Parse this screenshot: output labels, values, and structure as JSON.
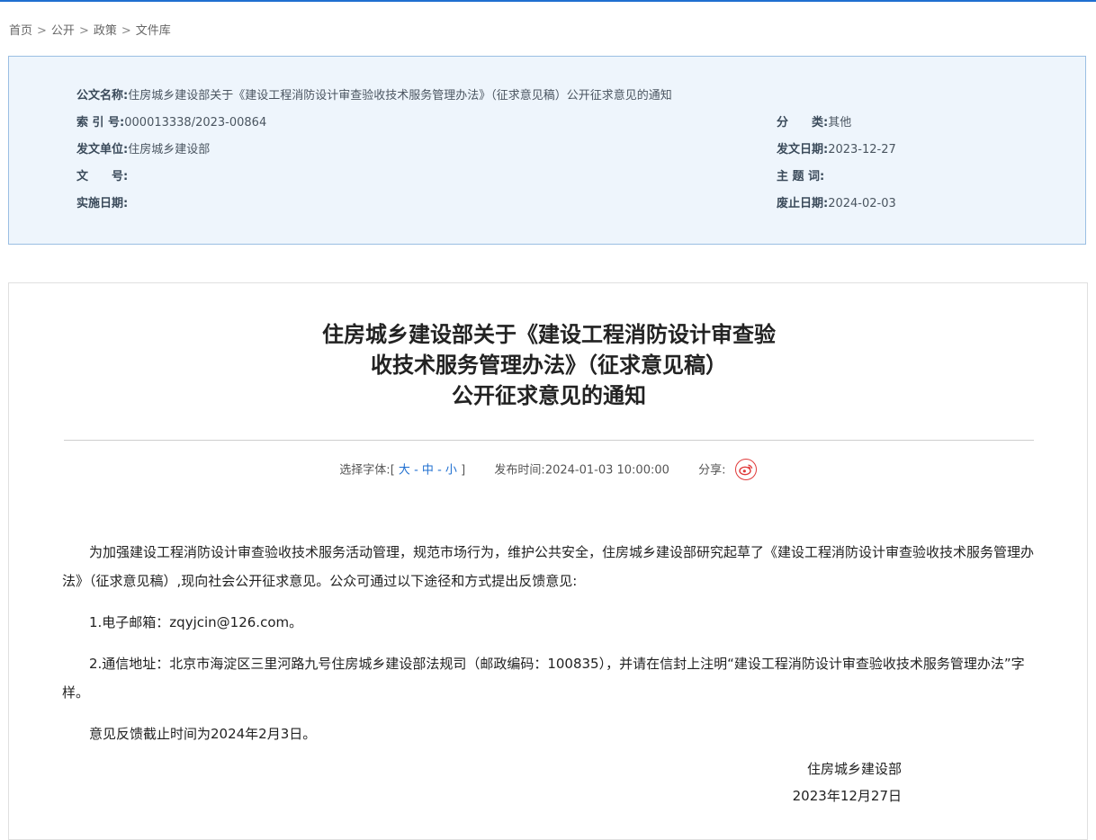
{
  "breadcrumb": {
    "items": [
      "首页",
      "公开",
      "政策",
      "文件库"
    ],
    "separator": ">"
  },
  "meta": {
    "doc_name_label": "公文名称:",
    "doc_name_value": "住房城乡建设部关于《建设工程消防设计审查验收技术服务管理办法》（征求意见稿）公开征求意见的通知",
    "index_label": "索 引 号:",
    "index_value": "000013338/2023-00864",
    "category_label": "分　　类:",
    "category_value": "其他",
    "issuer_label": "发文单位:",
    "issuer_value": "住房城乡建设部",
    "issue_date_label": "发文日期:",
    "issue_date_value": "2023-12-27",
    "doc_no_label": "文　　号:",
    "doc_no_value": "",
    "subject_label": "主 题 词:",
    "subject_value": "",
    "effective_label": "实施日期:",
    "effective_value": "",
    "expire_label": "废止日期:",
    "expire_value": "2024-02-03"
  },
  "article": {
    "title_lines": [
      "住房城乡建设部关于《建设工程消防设计审查验",
      "收技术服务管理办法》（征求意见稿）",
      "公开征求意见的通知"
    ],
    "font_size_label": "选择字体:",
    "bracket_open": "[",
    "size_large": "大",
    "size_medium": "中",
    "size_small": "小",
    "size_sep": "-",
    "bracket_close": "]",
    "publish_label": "发布时间:",
    "publish_time": "2024-01-03 10:00:00",
    "share_label": "分享:",
    "paragraphs": [
      "为加强建设工程消防设计审查验收技术服务活动管理，规范市场行为，维护公共安全，住房城乡建设部研究起草了《建设工程消防设计审查验收技术服务管理办法》（征求意见稿）,现向社会公开征求意见。公众可通过以下途径和方式提出反馈意见:",
      "1.电子邮箱：zqyjcin@126.com。",
      "2.通信地址：北京市海淀区三里河路九号住房城乡建设部法规司（邮政编码：100835），并请在信封上注明“建设工程消防设计审查验收技术服务管理办法”字样。",
      "意见反馈截止时间为2024年2月3日。"
    ],
    "sign_org": "住房城乡建设部",
    "sign_date": "2023年12月27日"
  },
  "icons": {
    "share": "weibo-icon"
  },
  "colors": {
    "accent": "#1f6fd0",
    "meta_bg": "#eef5fc",
    "meta_border": "#9bbfe3"
  }
}
